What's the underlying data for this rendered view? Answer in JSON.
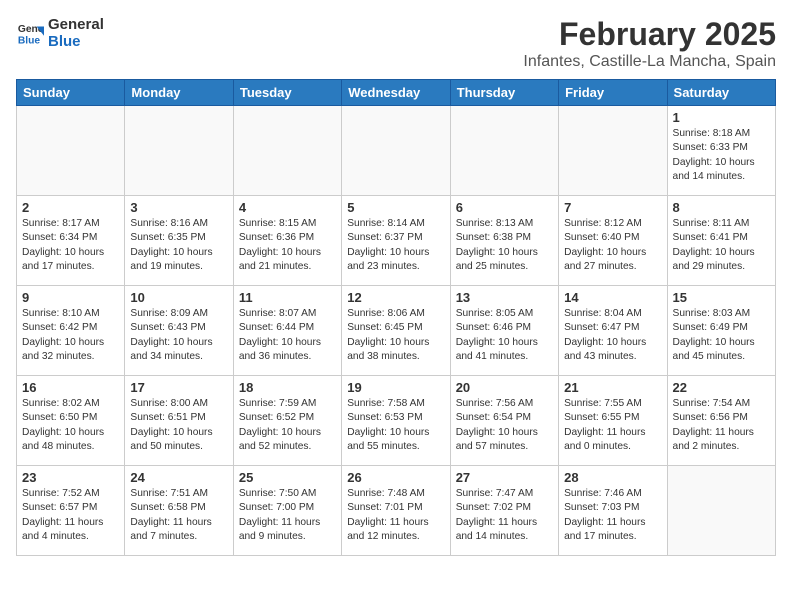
{
  "header": {
    "logo_line1": "General",
    "logo_line2": "Blue",
    "title": "February 2025",
    "subtitle": "Infantes, Castille-La Mancha, Spain"
  },
  "weekdays": [
    "Sunday",
    "Monday",
    "Tuesday",
    "Wednesday",
    "Thursday",
    "Friday",
    "Saturday"
  ],
  "weeks": [
    [
      {
        "day": "",
        "info": ""
      },
      {
        "day": "",
        "info": ""
      },
      {
        "day": "",
        "info": ""
      },
      {
        "day": "",
        "info": ""
      },
      {
        "day": "",
        "info": ""
      },
      {
        "day": "",
        "info": ""
      },
      {
        "day": "1",
        "info": "Sunrise: 8:18 AM\nSunset: 6:33 PM\nDaylight: 10 hours and 14 minutes."
      }
    ],
    [
      {
        "day": "2",
        "info": "Sunrise: 8:17 AM\nSunset: 6:34 PM\nDaylight: 10 hours and 17 minutes."
      },
      {
        "day": "3",
        "info": "Sunrise: 8:16 AM\nSunset: 6:35 PM\nDaylight: 10 hours and 19 minutes."
      },
      {
        "day": "4",
        "info": "Sunrise: 8:15 AM\nSunset: 6:36 PM\nDaylight: 10 hours and 21 minutes."
      },
      {
        "day": "5",
        "info": "Sunrise: 8:14 AM\nSunset: 6:37 PM\nDaylight: 10 hours and 23 minutes."
      },
      {
        "day": "6",
        "info": "Sunrise: 8:13 AM\nSunset: 6:38 PM\nDaylight: 10 hours and 25 minutes."
      },
      {
        "day": "7",
        "info": "Sunrise: 8:12 AM\nSunset: 6:40 PM\nDaylight: 10 hours and 27 minutes."
      },
      {
        "day": "8",
        "info": "Sunrise: 8:11 AM\nSunset: 6:41 PM\nDaylight: 10 hours and 29 minutes."
      }
    ],
    [
      {
        "day": "9",
        "info": "Sunrise: 8:10 AM\nSunset: 6:42 PM\nDaylight: 10 hours and 32 minutes."
      },
      {
        "day": "10",
        "info": "Sunrise: 8:09 AM\nSunset: 6:43 PM\nDaylight: 10 hours and 34 minutes."
      },
      {
        "day": "11",
        "info": "Sunrise: 8:07 AM\nSunset: 6:44 PM\nDaylight: 10 hours and 36 minutes."
      },
      {
        "day": "12",
        "info": "Sunrise: 8:06 AM\nSunset: 6:45 PM\nDaylight: 10 hours and 38 minutes."
      },
      {
        "day": "13",
        "info": "Sunrise: 8:05 AM\nSunset: 6:46 PM\nDaylight: 10 hours and 41 minutes."
      },
      {
        "day": "14",
        "info": "Sunrise: 8:04 AM\nSunset: 6:47 PM\nDaylight: 10 hours and 43 minutes."
      },
      {
        "day": "15",
        "info": "Sunrise: 8:03 AM\nSunset: 6:49 PM\nDaylight: 10 hours and 45 minutes."
      }
    ],
    [
      {
        "day": "16",
        "info": "Sunrise: 8:02 AM\nSunset: 6:50 PM\nDaylight: 10 hours and 48 minutes."
      },
      {
        "day": "17",
        "info": "Sunrise: 8:00 AM\nSunset: 6:51 PM\nDaylight: 10 hours and 50 minutes."
      },
      {
        "day": "18",
        "info": "Sunrise: 7:59 AM\nSunset: 6:52 PM\nDaylight: 10 hours and 52 minutes."
      },
      {
        "day": "19",
        "info": "Sunrise: 7:58 AM\nSunset: 6:53 PM\nDaylight: 10 hours and 55 minutes."
      },
      {
        "day": "20",
        "info": "Sunrise: 7:56 AM\nSunset: 6:54 PM\nDaylight: 10 hours and 57 minutes."
      },
      {
        "day": "21",
        "info": "Sunrise: 7:55 AM\nSunset: 6:55 PM\nDaylight: 11 hours and 0 minutes."
      },
      {
        "day": "22",
        "info": "Sunrise: 7:54 AM\nSunset: 6:56 PM\nDaylight: 11 hours and 2 minutes."
      }
    ],
    [
      {
        "day": "23",
        "info": "Sunrise: 7:52 AM\nSunset: 6:57 PM\nDaylight: 11 hours and 4 minutes."
      },
      {
        "day": "24",
        "info": "Sunrise: 7:51 AM\nSunset: 6:58 PM\nDaylight: 11 hours and 7 minutes."
      },
      {
        "day": "25",
        "info": "Sunrise: 7:50 AM\nSunset: 7:00 PM\nDaylight: 11 hours and 9 minutes."
      },
      {
        "day": "26",
        "info": "Sunrise: 7:48 AM\nSunset: 7:01 PM\nDaylight: 11 hours and 12 minutes."
      },
      {
        "day": "27",
        "info": "Sunrise: 7:47 AM\nSunset: 7:02 PM\nDaylight: 11 hours and 14 minutes."
      },
      {
        "day": "28",
        "info": "Sunrise: 7:46 AM\nSunset: 7:03 PM\nDaylight: 11 hours and 17 minutes."
      },
      {
        "day": "",
        "info": ""
      }
    ]
  ]
}
